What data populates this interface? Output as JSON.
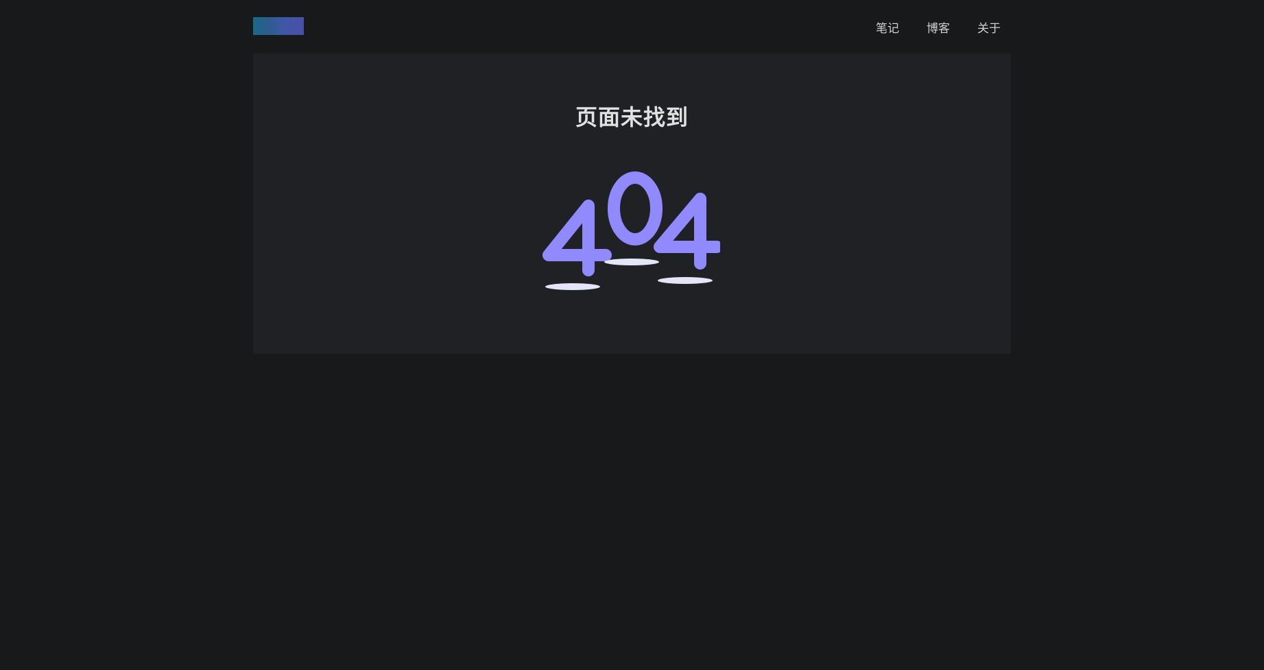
{
  "header": {
    "nav": [
      {
        "label": "笔记"
      },
      {
        "label": "博客"
      },
      {
        "label": "关于"
      }
    ]
  },
  "main": {
    "title": "页面未找到",
    "illustration_text": "404"
  },
  "colors": {
    "background": "#18191b",
    "card": "#202124",
    "digits": "#918aff",
    "shadows": "#e4e6f8",
    "nav_text": "#d0d0d0",
    "title_text": "#e1e1e1"
  }
}
